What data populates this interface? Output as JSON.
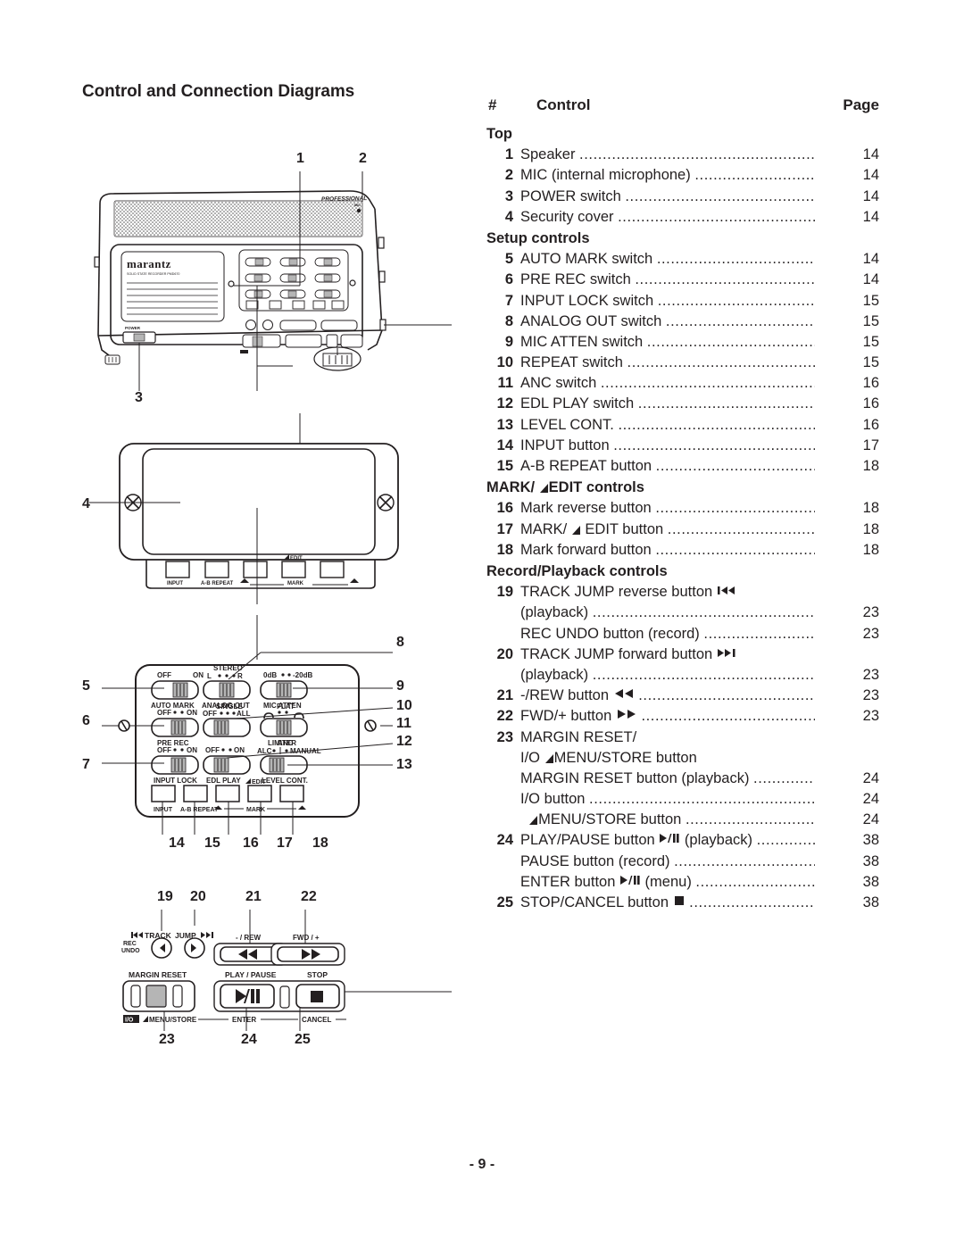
{
  "page_title": "Control and Connection Diagrams",
  "footer": "- 9 -",
  "list_header": {
    "hash": "#",
    "control": "Control",
    "page": "Page"
  },
  "groups": [
    {
      "heading": "Top",
      "rows": [
        {
          "num": "1",
          "text": "Speaker",
          "page": "14"
        },
        {
          "num": "2",
          "text": "MIC (internal microphone)",
          "page": "14"
        },
        {
          "num": "3",
          "text": "POWER switch",
          "page": "14"
        },
        {
          "num": "4",
          "text": "Security cover",
          "page": "14"
        }
      ]
    },
    {
      "heading": "Setup controls",
      "rows": [
        {
          "num": "5",
          "text": "AUTO MARK switch",
          "page": "14"
        },
        {
          "num": "6",
          "text": "PRE REC switch",
          "page": "14"
        },
        {
          "num": "7",
          "text": "INPUT LOCK switch",
          "page": "15"
        },
        {
          "num": "8",
          "text": "ANALOG OUT switch",
          "page": "15"
        },
        {
          "num": "9",
          "text": "MIC ATTEN switch",
          "page": "15"
        },
        {
          "num": "10",
          "text": "REPEAT switch",
          "page": "15"
        },
        {
          "num": "11",
          "text": "ANC switch",
          "page": "16"
        },
        {
          "num": "12",
          "text": "EDL PLAY switch",
          "page": "16"
        },
        {
          "num": "13",
          "text": "LEVEL CONT.",
          "page": "16"
        },
        {
          "num": "14",
          "text": "INPUT button",
          "page": "17"
        },
        {
          "num": "15",
          "text": "A-B REPEAT button",
          "page": "18"
        }
      ]
    },
    {
      "heading": "MARK/ ◢EDIT controls",
      "heading_parts": {
        "pre": "MARK/ ",
        "icon": "triangle-edit-icon",
        "post": "EDIT controls"
      },
      "rows": [
        {
          "num": "16",
          "text": "Mark reverse button",
          "page": "18"
        },
        {
          "num": "17",
          "text": "MARK/ ◢ EDIT button",
          "page": "18",
          "parts": {
            "pre": "MARK/ ",
            "icon": "triangle-edit-icon",
            "post": " EDIT button"
          }
        },
        {
          "num": "18",
          "text": "Mark forward button",
          "page": "18"
        }
      ]
    },
    {
      "heading": "Record/Playback controls",
      "rows": [
        {
          "num": "19",
          "text": "TRACK JUMP reverse button ⏮",
          "page": "",
          "icon": "track-jump-reverse-icon",
          "nodots": true
        },
        {
          "num": "",
          "text": "(playback)",
          "page": "23"
        },
        {
          "num": "",
          "text": "REC UNDO button (record)",
          "page": "23"
        },
        {
          "num": "20",
          "text": "TRACK JUMP forward button ⏭",
          "page": "",
          "icon": "track-jump-forward-icon",
          "nodots": true
        },
        {
          "num": "",
          "text": "(playback)",
          "page": "23"
        },
        {
          "num": "21",
          "text": "-/REW button ◀◀",
          "page": "23",
          "icon": "rewind-icon"
        },
        {
          "num": "22",
          "text": "FWD/+ button ▶▶",
          "page": "23",
          "icon": "forward-icon"
        },
        {
          "num": "23",
          "text": "MARGIN RESET/",
          "page": "",
          "nodots": true
        },
        {
          "num": "",
          "text": "I/O ◢MENU/STORE button",
          "page": "",
          "nodots": true,
          "parts": {
            "pre": "I/O ",
            "icon": "triangle-edit-icon",
            "post": "MENU/STORE button"
          }
        },
        {
          "num": "",
          "text": "MARGIN RESET button (playback)",
          "page": "24"
        },
        {
          "num": "",
          "text": "I/O button",
          "page": "24"
        },
        {
          "num": "",
          "text": "◢MENU/STORE button",
          "page": "24",
          "indent": true,
          "parts": {
            "pre": "",
            "icon": "triangle-edit-icon",
            "post": "MENU/STORE button"
          }
        },
        {
          "num": "24",
          "text": "PLAY/PAUSE button ▶/Ⅱ (playback)",
          "page": "38",
          "icon": "play-pause-icon"
        },
        {
          "num": "",
          "text": "PAUSE button (record)",
          "page": "38"
        },
        {
          "num": "",
          "text": "ENTER button ▶/Ⅱ (menu)",
          "page": "38",
          "icon": "play-pause-icon"
        },
        {
          "num": "25",
          "text": "STOP/CANCEL button ■",
          "page": "38",
          "icon": "stop-icon"
        }
      ]
    }
  ],
  "diagram": {
    "callouts_top": [
      "1",
      "2"
    ],
    "callout_power": "3",
    "callout_cover": "4",
    "callouts_left": [
      "5",
      "6",
      "7"
    ],
    "callouts_right": [
      "9",
      "10",
      "11",
      "12",
      "13"
    ],
    "callout_analog_out": "8",
    "callouts_buttons": [
      "14",
      "15",
      "16",
      "17",
      "18"
    ],
    "callouts_transport_top": [
      "19",
      "20",
      "21",
      "22"
    ],
    "callouts_transport_bottom": [
      "23",
      "24",
      "25"
    ],
    "brand": "marantz",
    "brand_sub": "SOLID STATE RECORDER PMD670",
    "professional": "PROFESSIONAL",
    "power_label": "POWER",
    "switch_labels": {
      "auto_mark": {
        "name": "AUTO MARK",
        "left": "OFF",
        "right": "ON"
      },
      "analog_out": {
        "name": "ANALOG  OUT",
        "top": "STEREO",
        "left": "L",
        "right": "R"
      },
      "mic_atten": {
        "name": "MIC ATTEN",
        "left": "0dB",
        "right": "-20dB"
      },
      "pre_rec": {
        "name": "PRE REC",
        "left": "OFF",
        "right": "ON"
      },
      "repeat": {
        "name": "",
        "top": "SINGLE",
        "left": "OFF",
        "right": "ALL"
      },
      "anc": {
        "name": "ANC",
        "top": "FLAT"
      },
      "input_lock": {
        "name": "INPUT LOCK",
        "left": "OFF",
        "right": "ON"
      },
      "edl_play": {
        "name": "EDL PLAY",
        "left": "OFF",
        "right": "ON"
      },
      "level_cont": {
        "name": "LEVEL CONT.",
        "top": "LIMITER",
        "left": "ALC",
        "right": "MANUAL"
      }
    },
    "button_labels": {
      "input": "INPUT",
      "ab_repeat": "A-B REPEAT",
      "mark": "MARK",
      "edit": "EDIT"
    },
    "transport_labels": {
      "track": "TRACK",
      "jump": "JUMP",
      "rec_undo_1": "REC",
      "rec_undo_2": "UNDO",
      "rew": "- / REW",
      "fwd": "FWD / +",
      "margin_reset": "MARGIN RESET",
      "play_pause": "PLAY / PAUSE",
      "stop": "STOP",
      "io": "I/O",
      "menu_store": "MENU/STORE",
      "enter": "ENTER",
      "cancel": "CANCEL"
    }
  }
}
